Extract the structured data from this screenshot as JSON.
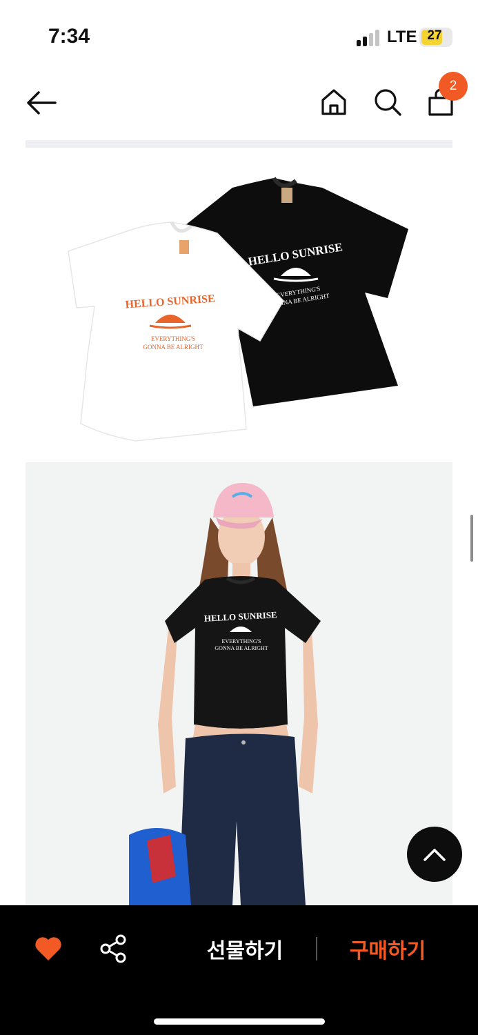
{
  "status_bar": {
    "time": "7:34",
    "network": "LTE",
    "battery_level": "27",
    "battery_color": "#f5d431",
    "signal_bars_active": 2,
    "signal_bars_total": 4
  },
  "header": {
    "back_icon": "arrow-left-icon",
    "home_icon": "home-icon",
    "search_icon": "search-icon",
    "cart_icon": "shopping-bag-icon",
    "cart_count": "2",
    "badge_color": "#f15a24"
  },
  "product_images": [
    {
      "name": "tshirt-pair-photo",
      "graphic_lines": [
        "HELLO SUNRISE",
        "EVERYTHING'S",
        "GONNA BE ALRIGHT"
      ],
      "white_print_color": "#e8642a"
    },
    {
      "name": "model-wearing-black-tshirt-photo",
      "graphic_lines": [
        "HELLO SUNRISE",
        "EVERYTHING'S",
        "GONNA BE ALRIGHT"
      ]
    }
  ],
  "bottom_bar": {
    "like_icon": "heart-icon",
    "like_color": "#f15a24",
    "share_icon": "share-icon",
    "gift_label": "선물하기",
    "buy_label": "구매하기",
    "buy_color": "#f15a24"
  },
  "scroll_top_icon": "chevron-up-icon"
}
